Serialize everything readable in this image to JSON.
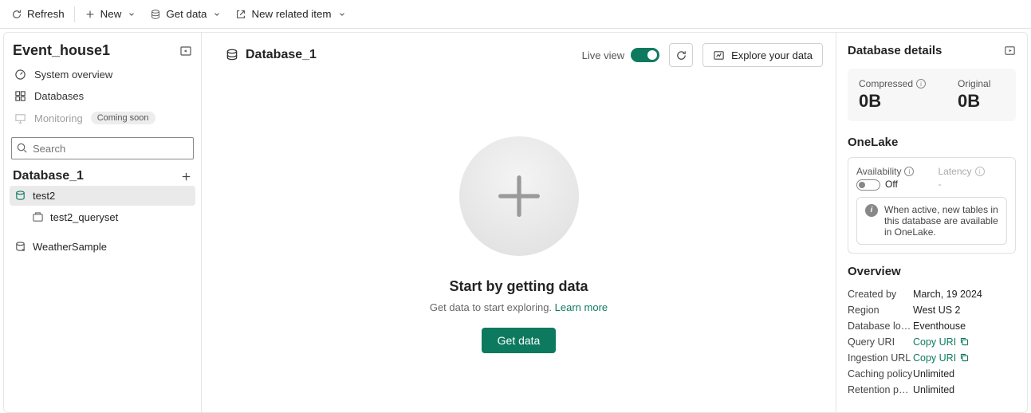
{
  "toolbar": {
    "refresh": "Refresh",
    "new": "New",
    "get_data": "Get data",
    "new_related": "New related item"
  },
  "eventhouse": {
    "title": "Event_house1",
    "nav": {
      "overview": "System overview",
      "databases": "Databases",
      "monitoring": "Monitoring",
      "monitoring_badge": "Coming soon"
    },
    "search_placeholder": "Search"
  },
  "database_tree": {
    "title": "Database_1",
    "items": [
      {
        "name": "test2"
      },
      {
        "name": "test2_queryset"
      },
      {
        "name": "WeatherSample"
      }
    ]
  },
  "main": {
    "db_name": "Database_1",
    "live_view": "Live view",
    "explore": "Explore your data",
    "empty_title": "Start by getting data",
    "empty_sub": "Get data to start exploring. ",
    "learn_more": "Learn more",
    "get_data_btn": "Get data"
  },
  "details": {
    "title": "Database details",
    "compressed_label": "Compressed",
    "compressed_val": "0B",
    "original_label": "Original",
    "original_val": "0B",
    "onelake_title": "OneLake",
    "availability_label": "Availability",
    "availability_val": "Off",
    "latency_label": "Latency",
    "latency_val": "-",
    "onelake_note": "When active, new tables in this database are available in OneLake.",
    "overview_title": "Overview",
    "overview": {
      "created_by_k": "Created by",
      "created_by_v": "March, 19 2024",
      "region_k": "Region",
      "region_v": "West US 2",
      "location_k": "Database locati...",
      "location_v": "Eventhouse",
      "query_k": "Query URI",
      "query_v": "Copy URI",
      "ingestion_k": "Ingestion URL",
      "ingestion_v": "Copy URI",
      "caching_k": "Caching policy",
      "caching_v": "Unlimited",
      "retention_k": "Retention policy",
      "retention_v": "Unlimited"
    }
  }
}
